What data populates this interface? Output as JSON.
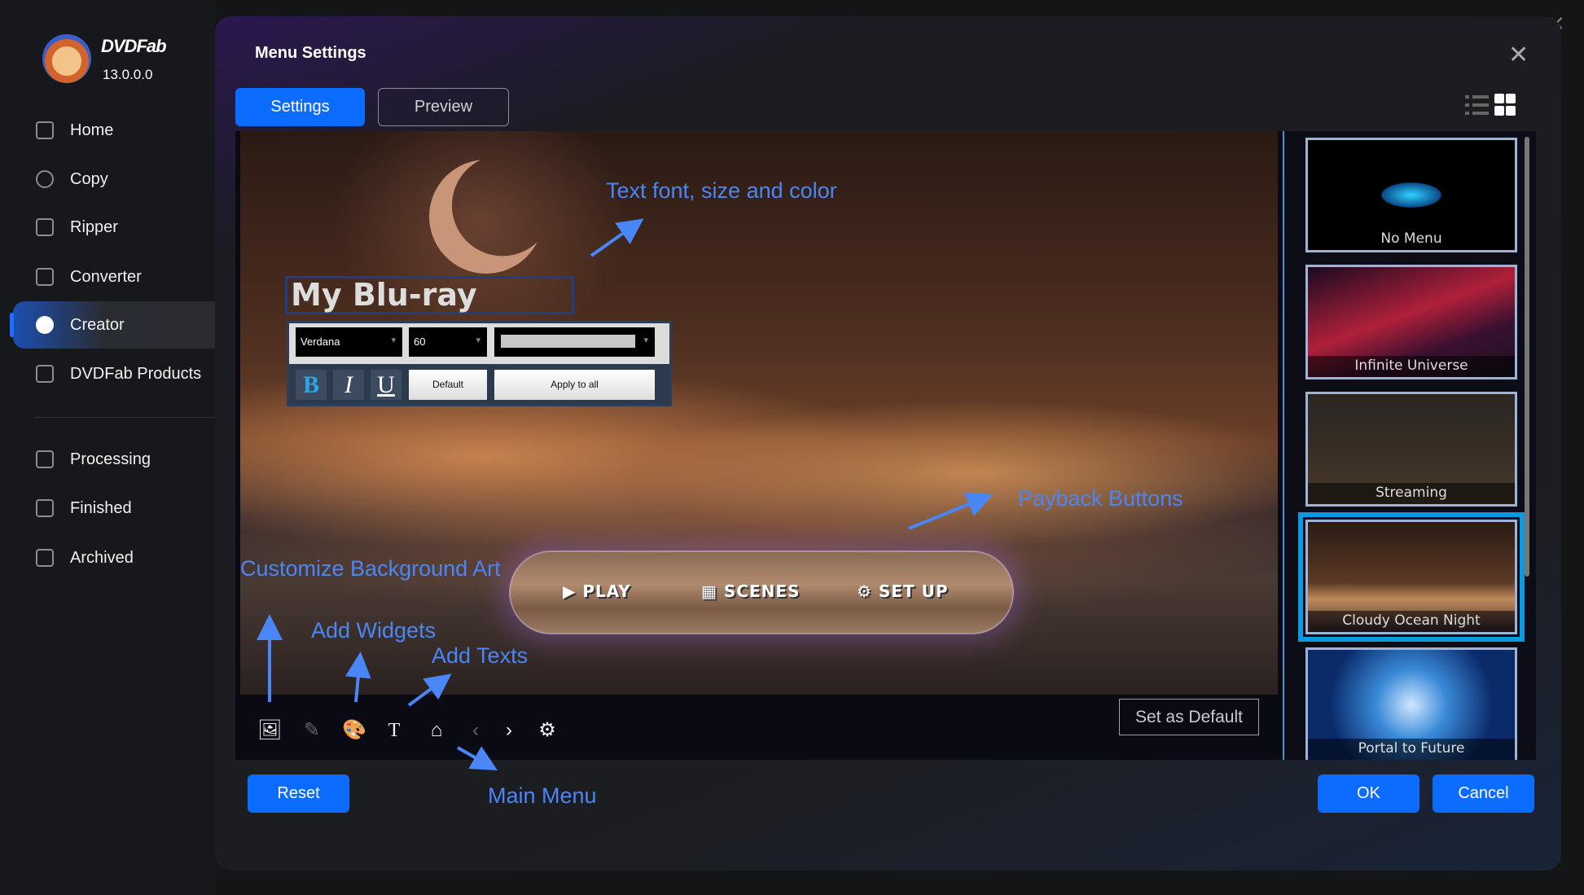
{
  "app": {
    "brand": "DVDFab",
    "version": "13.0.0.0"
  },
  "sidebar": {
    "items": [
      {
        "label": "Home",
        "icon": "home-icon"
      },
      {
        "label": "Copy",
        "icon": "copy-icon"
      },
      {
        "label": "Ripper",
        "icon": "ripper-icon"
      },
      {
        "label": "Converter",
        "icon": "converter-icon"
      },
      {
        "label": "Creator",
        "icon": "creator-icon",
        "active": true
      },
      {
        "label": "DVDFab Products",
        "icon": "products-icon"
      },
      {
        "label": "Processing",
        "icon": "processing-icon"
      },
      {
        "label": "Finished",
        "icon": "finished-icon"
      },
      {
        "label": "Archived",
        "icon": "archived-icon"
      }
    ]
  },
  "dialog": {
    "title": "Menu Settings",
    "tabs": [
      {
        "label": "Settings",
        "active": true
      },
      {
        "label": "Preview"
      }
    ],
    "view_modes": [
      "list-view-icon",
      "grid-view-icon"
    ],
    "active_view": "grid"
  },
  "canvas": {
    "menu_title": "My Blu-ray",
    "format": {
      "font": "Verdana",
      "size": "60",
      "color": "#c8c8c8",
      "bold": "B",
      "italic": "I",
      "underline": "U",
      "default_label": "Default",
      "apply_all_label": "Apply to all"
    },
    "playback": {
      "play": "PLAY",
      "scenes": "SCENES",
      "setup": "SET UP"
    },
    "annotations": {
      "text_font": "Text font, size and color",
      "payback": "Payback Buttons",
      "background": "Customize Background Art",
      "widgets": "Add Widgets",
      "texts": "Add Texts",
      "main_menu": "Main Menu"
    },
    "toolbar": [
      "image-icon",
      "edit-icon",
      "palette-icon",
      "text-icon",
      "home-icon",
      "chevron-left-icon",
      "chevron-right-icon",
      "settings-icon"
    ],
    "set_default_label": "Set as Default"
  },
  "templates": [
    {
      "label": "No Menu"
    },
    {
      "label": "Infinite Universe"
    },
    {
      "label": "Streaming"
    },
    {
      "label": "Cloudy Ocean Night",
      "selected": true
    },
    {
      "label": "Portal to Future"
    }
  ],
  "footer": {
    "reset": "Reset",
    "ok": "OK",
    "cancel": "Cancel"
  },
  "colors": {
    "accent": "#0b6cff",
    "annotation": "#4a86f5",
    "selected_template": "#0a9ae0"
  }
}
